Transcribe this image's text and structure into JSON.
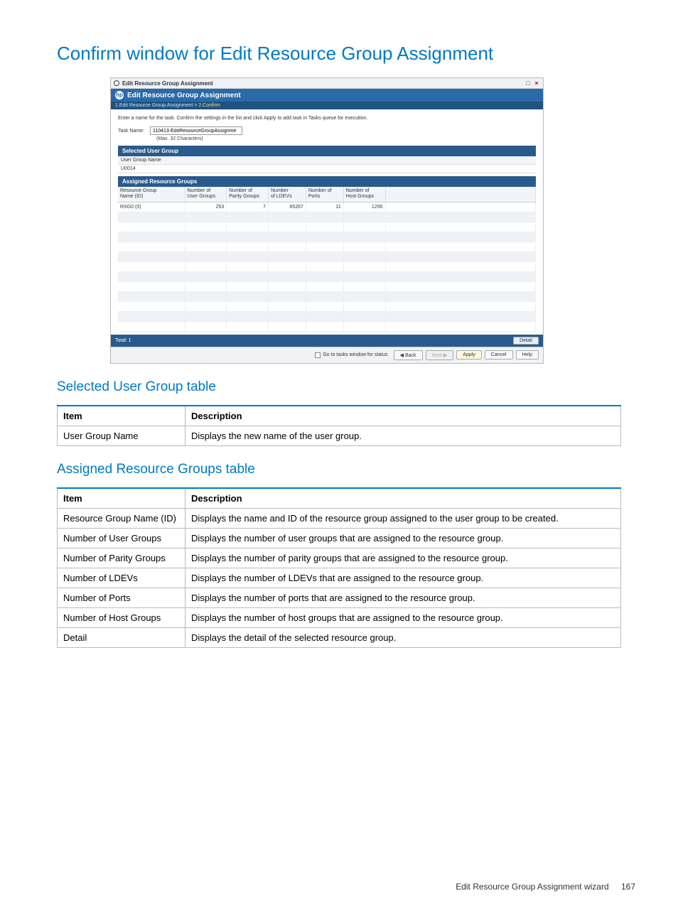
{
  "doc": {
    "title": "Confirm window for Edit Resource Group Assignment",
    "sub_selected": "Selected User Group table",
    "sub_assigned": "Assigned Resource Groups table",
    "footer_label": "Edit Resource Group Assignment wizard",
    "footer_page": "167"
  },
  "shot": {
    "chrome_title": "Edit Resource Group Assignment",
    "header_title": "Edit Resource Group Assignment",
    "breadcrumb_prev": "1.Edit Resource Group Assignment  >",
    "breadcrumb_cur": "2.Confirm",
    "instruction": "Enter a name for the task. Confirm the settings in the list and click Apply to add task in Tasks queue for execution.",
    "task_label": "Task Name:",
    "task_value": "110413-EditResourceGroupAssignme",
    "task_note": "(Max. 32 Characters)",
    "selected_bar": "Selected User Group",
    "selected_col": "User Group Name",
    "selected_val": "U0014",
    "assigned_bar": "Assigned Resource Groups",
    "rg_headers": {
      "c0a": "Resource Group",
      "c0b": "Name (ID)",
      "c1a": "Number of",
      "c1b": "User Groups",
      "c2a": "Number of",
      "c2b": "Parity Groups",
      "c3a": "Number",
      "c3b": "of LDEVs",
      "c4a": "Number of",
      "c4b": "Ports",
      "c5a": "Number of",
      "c5b": "Host Groups"
    },
    "rg_row": {
      "name": "RSG0 (0)",
      "ug": "253",
      "pg": "7",
      "ldev": "65267",
      "ports": "11",
      "hg": "1295"
    },
    "total_label": "Total: 1",
    "detail_label": "Detail",
    "check_label": "Go to tasks window for status",
    "back": "Back",
    "next": "Next",
    "apply": "Apply",
    "cancel": "Cancel",
    "help": "Help"
  },
  "tbl1": {
    "h1": "Item",
    "h2": "Description",
    "r1c1": "User Group Name",
    "r1c2": "Displays the new name of the user group."
  },
  "tbl2": {
    "h1": "Item",
    "h2": "Description",
    "rows": [
      {
        "i": "Resource Group Name (ID)",
        "d": "Displays the name and ID of the resource group assigned to the user group to be created."
      },
      {
        "i": "Number of User Groups",
        "d": "Displays the number of user groups that are assigned to the resource group."
      },
      {
        "i": "Number of Parity Groups",
        "d": "Displays the number of parity groups that are assigned to the resource group."
      },
      {
        "i": "Number of LDEVs",
        "d": "Displays the number of LDEVs that are assigned to the resource group."
      },
      {
        "i": "Number of Ports",
        "d": "Displays the number of ports that are assigned to the resource group."
      },
      {
        "i": "Number of Host Groups",
        "d": "Displays the number of host groups that are assigned to the resource group."
      },
      {
        "i": "Detail",
        "d": "Displays the detail of the selected resource group."
      }
    ]
  }
}
